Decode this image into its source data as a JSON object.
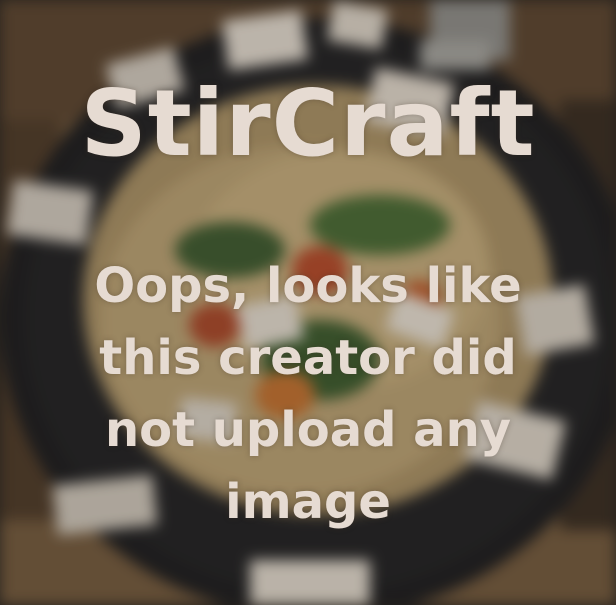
{
  "brand": "StirCraft",
  "message": "Oops, looks like this creator did not upload any image",
  "background": {
    "description_icon": "pasta-plate-photo",
    "colors": {
      "plate": "#1c1c1e",
      "table": "#6b5339",
      "text": "#e6dbd2"
    }
  }
}
